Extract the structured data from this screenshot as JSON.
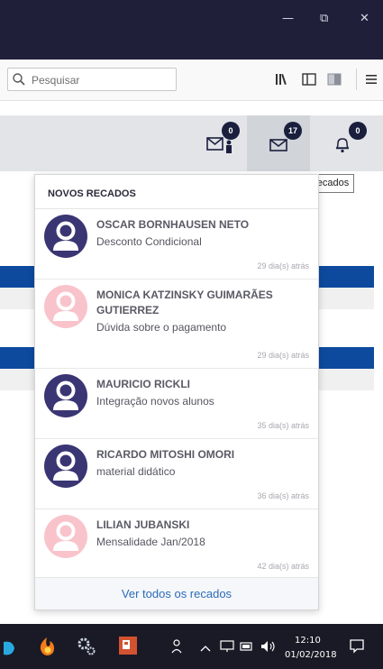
{
  "window": {
    "minimize_glyph": "—",
    "restore_glyph": "⧉",
    "close_glyph": "✕"
  },
  "toolbar": {
    "search_placeholder": "Pesquisar",
    "icons": [
      "library-icon",
      "sidebar-icon",
      "reader-icon",
      "menu-icon"
    ]
  },
  "nav": {
    "badges": {
      "requests": "0",
      "messages": "17",
      "notifications": "0"
    }
  },
  "tooltip": {
    "text": "Recados"
  },
  "dropdown": {
    "header": "NOVOS RECADOS",
    "messages": [
      {
        "name": "OSCAR BORNHAUSEN NETO",
        "subject": "Desconto Condicional",
        "time": "29 dia(s) atrás",
        "avatar_color": "#3a3573"
      },
      {
        "name": "MONICA KATZINSKY GUIMARÃES GUTIERREZ",
        "subject": "Dúvida sobre o pagamento",
        "time": "29 dia(s) atrás",
        "avatar_color": "#f9c3cb"
      },
      {
        "name": "MAURICIO RICKLI",
        "subject": "Integração novos alunos",
        "time": "35 dia(s) atrás",
        "avatar_color": "#3a3573"
      },
      {
        "name": "RICARDO MITOSHI OMORI",
        "subject": "material didático",
        "time": "36 dia(s) atrás",
        "avatar_color": "#3a3573"
      },
      {
        "name": "LILIAN JUBANSKI",
        "subject": "Mensalidade Jan/2018",
        "time": "42 dia(s) atrás",
        "avatar_color": "#f9c3cb"
      }
    ],
    "footer_link": "Ver todos os recados"
  },
  "taskbar": {
    "clock_time": "12:10",
    "clock_date": "01/02/2018"
  },
  "colors": {
    "titlebar": "#1f1f3a",
    "accent_blue": "#0d4a9e",
    "badge": "#1a1f3d",
    "link": "#2d6bb8"
  }
}
